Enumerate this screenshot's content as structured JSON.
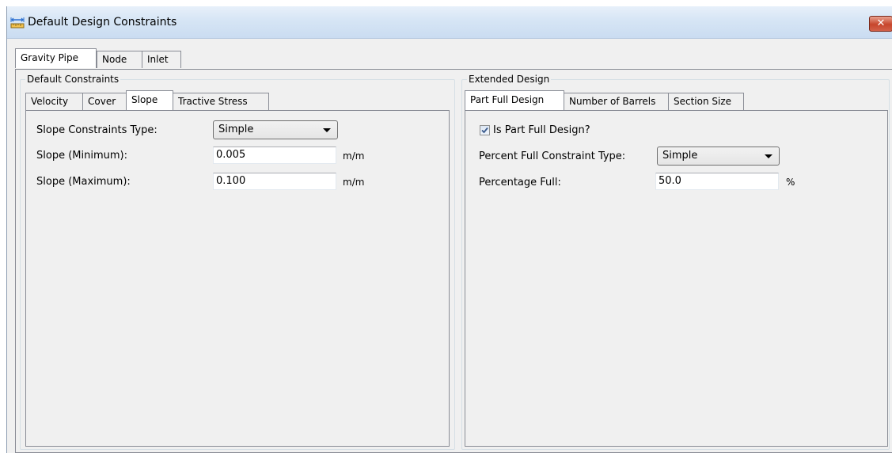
{
  "window": {
    "title": "Default Design Constraints",
    "close_label": "✕"
  },
  "outer_tabs": [
    "Gravity Pipe",
    "Node",
    "Inlet"
  ],
  "default_constraints": {
    "group_label": "Default Constraints",
    "tabs": [
      "Velocity",
      "Cover",
      "Slope",
      "Tractive Stress"
    ],
    "active_tab": "Slope",
    "fields": {
      "type_label": "Slope Constraints Type:",
      "type_value": "Simple",
      "min_label": "Slope (Minimum):",
      "min_value": "0.005",
      "min_unit": "m/m",
      "max_label": "Slope (Maximum):",
      "max_value": "0.100",
      "max_unit": "m/m"
    }
  },
  "extended_design": {
    "group_label": "Extended Design",
    "tabs": [
      "Part Full Design",
      "Number of Barrels",
      "Section Size"
    ],
    "active_tab": "Part Full Design",
    "fields": {
      "checkbox_label": "Is Part Full Design?",
      "checkbox_checked": true,
      "type_label": "Percent Full Constraint Type:",
      "type_value": "Simple",
      "pct_label": "Percentage Full:",
      "pct_value": "50.0",
      "pct_unit": "%"
    }
  },
  "colors": {
    "title_gradient_top": "#e7f0fa",
    "close_button": "#c7462c",
    "panel_bg": "#f0f0f0"
  }
}
